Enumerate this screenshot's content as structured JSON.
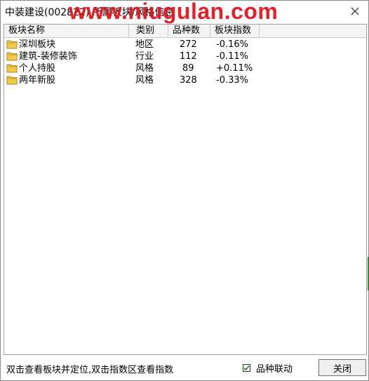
{
  "window": {
    "title": "中装建设(002822) 所属板块/风格信息",
    "watermark": "www.niugulan.com"
  },
  "table": {
    "columns": [
      "板块名称",
      "类别",
      "品种数",
      "板块指数"
    ],
    "rows": [
      {
        "name": "深圳板块",
        "category": "地区",
        "count": "272",
        "index": "-0.16%"
      },
      {
        "name": "建筑-装修装饰",
        "category": "行业",
        "count": "112",
        "index": "-0.11%"
      },
      {
        "name": "个人持股",
        "category": "风格",
        "count": "89",
        "index": "+0.11%"
      },
      {
        "name": "两年新股",
        "category": "风格",
        "count": "328",
        "index": "-0.33%"
      }
    ]
  },
  "footer": {
    "hint": "双击查看板块并定位,双击指数区查看指数",
    "checkbox_label": "品种联动",
    "checkbox_checked": true,
    "close_label": "关闭"
  },
  "icons": {
    "close": "close-icon",
    "folder": "folder-icon",
    "check": "checkmark-icon"
  },
  "colors": {
    "watermark": "#e8131e",
    "folder": "#f2c94c",
    "check": "#2a7a2a"
  }
}
